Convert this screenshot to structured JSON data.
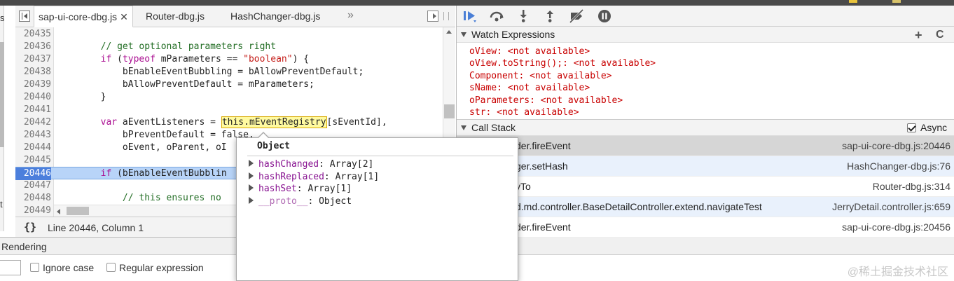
{
  "colors": {
    "strip_marks": [
      "#e8c23a",
      "#d8c36a"
    ],
    "highlight_token": "#fffaa0",
    "exec_line": "#b8d4f8",
    "watch_value": "#c80000",
    "property_name": "#881391"
  },
  "left_column": {
    "top_letter": "s",
    "bottom_letter": "t"
  },
  "editor": {
    "tabs": [
      {
        "label": "sap-ui-core-dbg.js",
        "closable": true,
        "active": true
      },
      {
        "label": "Router-dbg.js",
        "closable": false,
        "active": false
      },
      {
        "label": "HashChanger-dbg.js",
        "closable": false,
        "active": false
      }
    ],
    "more_tabs": "»",
    "code_lines": [
      {
        "num": "20435",
        "code": ""
      },
      {
        "num": "20436",
        "code": "        // get optional parameters right"
      },
      {
        "num": "20437",
        "code": "        if (typeof mParameters == \"boolean\") {"
      },
      {
        "num": "20438",
        "code": "            bEnableEventBubbling = bAllowPreventDefault;"
      },
      {
        "num": "20439",
        "code": "            bAllowPreventDefault = mParameters;"
      },
      {
        "num": "20440",
        "code": "        }"
      },
      {
        "num": "20441",
        "code": ""
      },
      {
        "num": "20442",
        "code": "        var aEventListeners = this.mEventRegistry[sEventId],"
      },
      {
        "num": "20443",
        "code": "            bPreventDefault = false,"
      },
      {
        "num": "20444",
        "code": "            oEvent, oParent, oI"
      },
      {
        "num": "20445",
        "code": ""
      },
      {
        "num": "20446",
        "code": "        if (bEnableEventBubblin"
      },
      {
        "num": "20447",
        "code": ""
      },
      {
        "num": "20448",
        "code": "            // this ensures no"
      },
      {
        "num": "20449",
        "code": ""
      }
    ],
    "highlighted_token": "this.mEventRegistry",
    "status": {
      "pretty_print": "{}",
      "position": "Line 20446, Column 1"
    }
  },
  "drawer": {
    "tab_label": "Rendering",
    "search_value": "",
    "ignore_case_label": "Ignore case",
    "regex_label": "Regular expression"
  },
  "debugger": {
    "toolbar": [
      "resume-icon",
      "step-over-icon",
      "step-into-icon",
      "step-out-icon",
      "deactivate-breakpoints-icon",
      "pause-on-exceptions-icon"
    ],
    "watch": {
      "title": "Watch Expressions",
      "add_label": "+",
      "refresh_label": "C",
      "items": [
        {
          "name": "oView",
          "value": "<not available>"
        },
        {
          "name": "oView.toString();",
          "value": "<not available>"
        },
        {
          "name": "Component",
          "value": "<not available>"
        },
        {
          "name": "sName",
          "value": "<not available>"
        },
        {
          "name": "oParameters",
          "value": "<not available>"
        },
        {
          "name": "str",
          "value": "<not available>"
        }
      ]
    },
    "call_stack": {
      "title": "Call Stack",
      "async_label": "Async",
      "async_checked": true,
      "frames": [
        {
          "fn": "der.fireEvent",
          "loc": "sap-ui-core-dbg.js:20446",
          "state": "selected"
        },
        {
          "fn": "ger.setHash",
          "loc": "HashChanger-dbg.js:76",
          "state": "alt"
        },
        {
          "fn": "yTo",
          "loc": "Router-dbg.js:314",
          "state": "normal"
        },
        {
          "fn": "d.md.controller.BaseDetailController.extend.navigateTest",
          "loc": "JerryDetail.controller.js:659",
          "state": "alt"
        },
        {
          "fn": "der.fireEvent",
          "loc": "sap-ui-core-dbg.js:20456",
          "state": "normal"
        }
      ]
    }
  },
  "popover": {
    "title": "Object",
    "props": [
      {
        "name": "hashChanged",
        "value": "Array[2]",
        "dim": false
      },
      {
        "name": "hashReplaced",
        "value": "Array[1]",
        "dim": false
      },
      {
        "name": "hashSet",
        "value": "Array[1]",
        "dim": false
      },
      {
        "name": "__proto__",
        "value": "Object",
        "dim": true
      }
    ]
  },
  "watermark": "@稀土掘金技术社区"
}
